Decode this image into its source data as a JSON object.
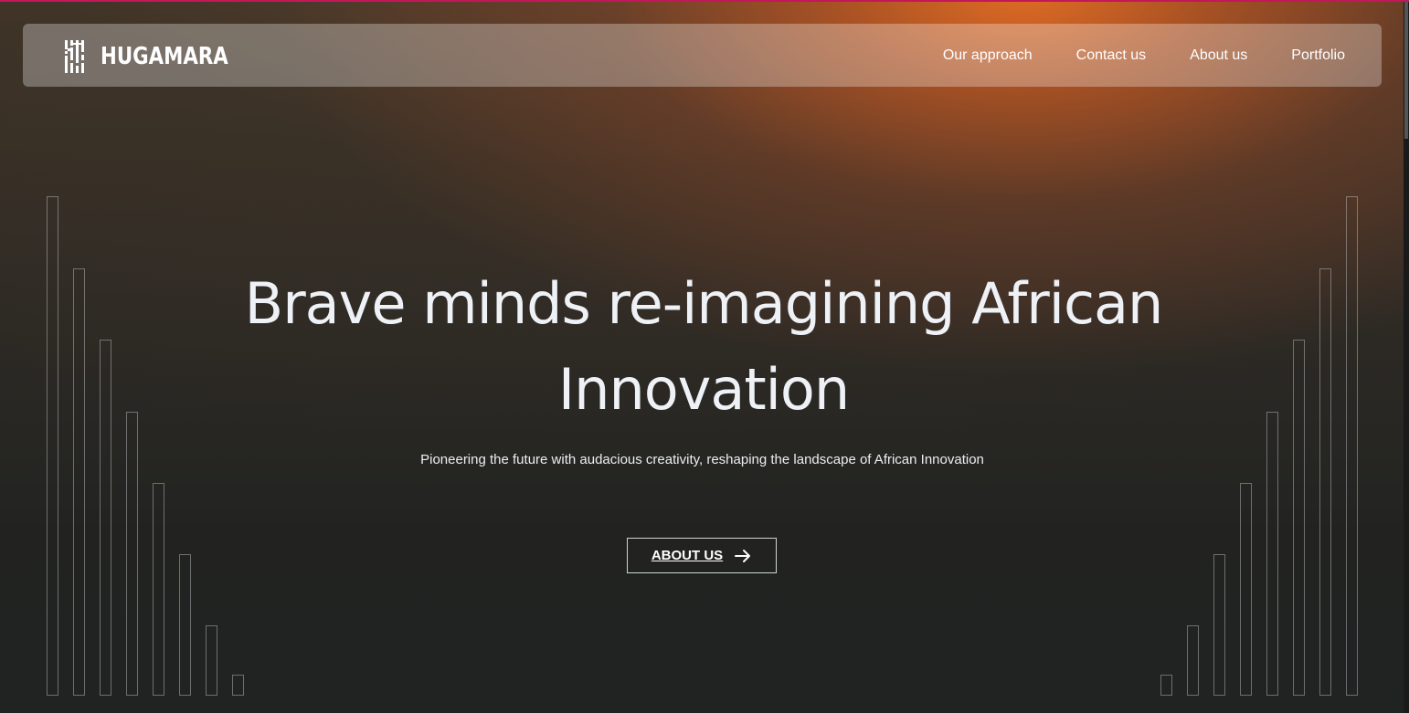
{
  "brand": {
    "name": "HUGAMARA",
    "logo_icon": "hm-monogram-icon"
  },
  "nav": {
    "items": [
      {
        "label": "Our approach"
      },
      {
        "label": "Contact us"
      },
      {
        "label": "About us"
      },
      {
        "label": "Portfolio"
      }
    ]
  },
  "hero": {
    "title_line1": "Brave minds re-imagining African",
    "title_line2": "Innovation",
    "subtitle": "Pioneering the future with audacious creativity, reshaping the landscape of African Innovation",
    "cta_label": "ABOUT US",
    "cta_icon": "arrow-right-icon"
  },
  "colors": {
    "accent": "#e0662a",
    "text": "#eef1f6",
    "background_dark": "#1f2322"
  }
}
